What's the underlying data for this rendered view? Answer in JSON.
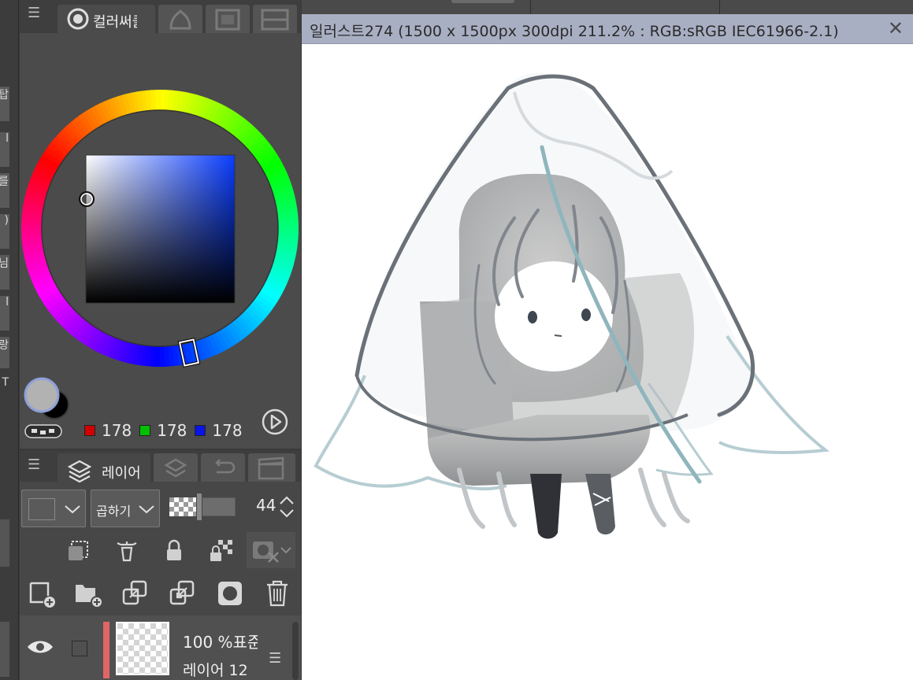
{
  "left_strip": {
    "tab_chars": [
      "탑",
      "l",
      "를",
      ")",
      "님",
      "l",
      "랑",
      "T"
    ]
  },
  "color_panel": {
    "menu_icon": "hamburger-icon",
    "active_tab_label": "컬러써클",
    "other_tabs": [
      "color-set-icon",
      "intermediate-color-icon",
      "approx-color-icon"
    ],
    "wheel": {
      "hue_color": "#0a3dff",
      "selected_color": "#b2b2b2",
      "background_color": "#000000"
    },
    "rgb": {
      "r_label": "178",
      "g_label": "178",
      "b_label": "178",
      "r_chip": "#d20000",
      "g_chip": "#00c000",
      "b_chip": "#0a14e6"
    }
  },
  "layer_panel": {
    "menu_icon": "hamburger-icon",
    "active_tab_label": "레이어",
    "blend_mode": "곱하기",
    "opacity": "44",
    "layer": {
      "percent_text": "100 %표준",
      "name": "레이어 12",
      "color_tag": "#e06666"
    }
  },
  "canvas": {
    "title": "일러스트274 (1500 x 1500px 300dpi 211.2% : RGB:sRGB IEC61966-2.1)",
    "close_glyph": "✕"
  }
}
